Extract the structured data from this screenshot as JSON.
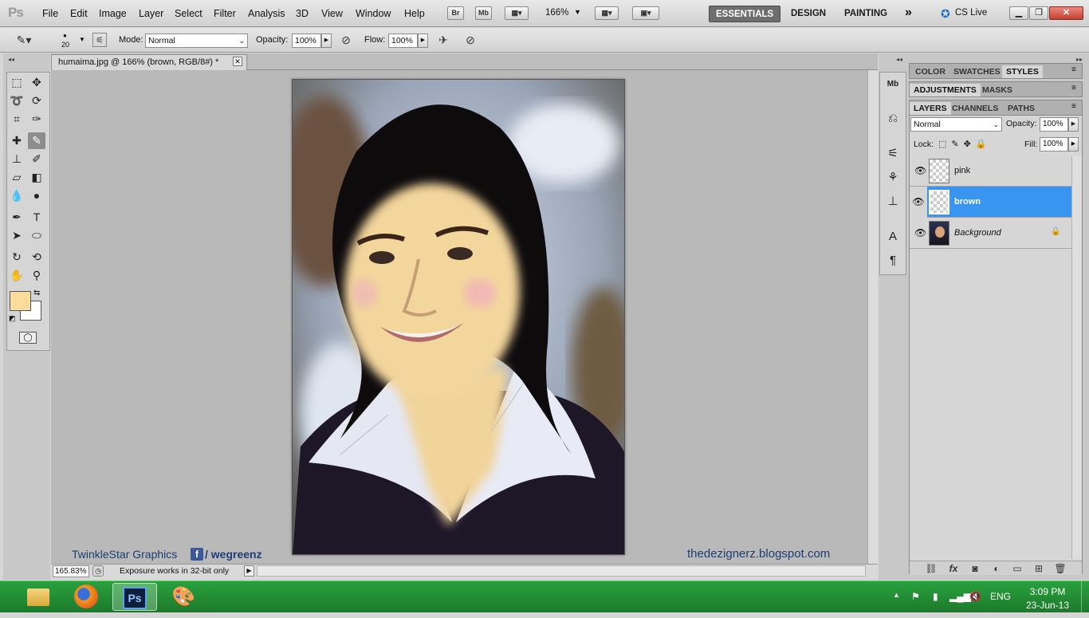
{
  "menubar": {
    "logo": "Ps",
    "items": [
      "File",
      "Edit",
      "Image",
      "Layer",
      "Select",
      "Filter",
      "Analysis",
      "3D",
      "View",
      "Window",
      "Help"
    ],
    "bridge_label": "Br",
    "minibridge_label": "Mb",
    "zoom": "166%",
    "workspaces": [
      "ESSENTIALS",
      "DESIGN",
      "PAINTING"
    ],
    "more": "»",
    "cs_live": "CS Live"
  },
  "options": {
    "brush_size": "20",
    "mode_label": "Mode:",
    "mode_value": "Normal",
    "opacity_label": "Opacity:",
    "opacity_value": "100%",
    "flow_label": "Flow:",
    "flow_value": "100%"
  },
  "document": {
    "tab_title": "humaima.jpg @ 166% (brown, RGB/8#) *",
    "zoom_readout": "165.83%",
    "status": "Exposure works in 32-bit only"
  },
  "watermarks": {
    "left": "TwinkleStar Graphics",
    "fb": "/ wegreenz",
    "right": "thedezignerz.blogspot.com"
  },
  "colors": {
    "foreground": "#fbdc9a",
    "background": "#ffffff",
    "accent": "#3a95f0"
  },
  "panels": {
    "tabs_row1": [
      "COLOR",
      "SWATCHES",
      "STYLES"
    ],
    "tabs_row2": [
      "ADJUSTMENTS",
      "MASKS"
    ],
    "tabs_row3": [
      "LAYERS",
      "CHANNELS",
      "PATHS"
    ],
    "blend_mode": "Normal",
    "opacity_label": "Opacity:",
    "opacity_value": "100%",
    "lock_label": "Lock:",
    "fill_label": "Fill:",
    "fill_value": "100%",
    "layers": [
      {
        "name": "pink",
        "selected": false
      },
      {
        "name": "brown",
        "selected": true
      },
      {
        "name": "Background",
        "selected": false,
        "locked": true
      }
    ]
  },
  "taskbar": {
    "ps_label": "Ps",
    "lang": "ENG",
    "time": "3:09 PM",
    "date": "23-Jun-13"
  }
}
